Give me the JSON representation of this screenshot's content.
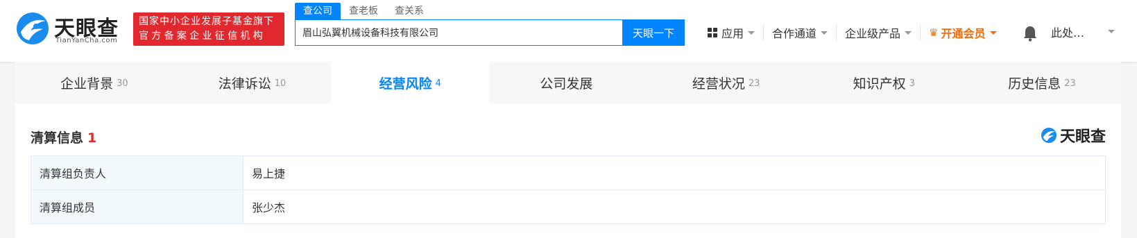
{
  "header": {
    "logo": {
      "name": "天眼查",
      "domain": "TianYanCha.com"
    },
    "slogan": [
      "国家中小企业发展子基金旗下",
      "官方备案企业征信机构"
    ],
    "search_tabs": [
      {
        "label": "查公司",
        "active": true
      },
      {
        "label": "查老板",
        "active": false
      },
      {
        "label": "查关系",
        "active": false
      }
    ],
    "search": {
      "value": "眉山弘翼机械设备科技有限公司",
      "button": "天眼一下"
    },
    "nav": {
      "apps": "应用",
      "partner": "合作通道",
      "enterprise": "企业级产品",
      "vip": "开通会员"
    },
    "user": "此处…",
    "accent_color": "#0084ff",
    "vip_color": "#f36b0b"
  },
  "tabs": [
    {
      "label": "企业背景",
      "count": "30",
      "active": false
    },
    {
      "label": "法律诉讼",
      "count": "10",
      "active": false
    },
    {
      "label": "经营风险",
      "count": "4",
      "active": true
    },
    {
      "label": "公司发展",
      "count": "",
      "active": false
    },
    {
      "label": "经营状况",
      "count": "23",
      "active": false
    },
    {
      "label": "知识产权",
      "count": "3",
      "active": false
    },
    {
      "label": "历史信息",
      "count": "23",
      "active": false
    }
  ],
  "section": {
    "title": "清算信息",
    "count": "1",
    "watermark": "天眼查",
    "rows": [
      {
        "label": "清算组负责人",
        "value": "易上捷"
      },
      {
        "label": "清算组成员",
        "value": "张少杰"
      }
    ]
  }
}
